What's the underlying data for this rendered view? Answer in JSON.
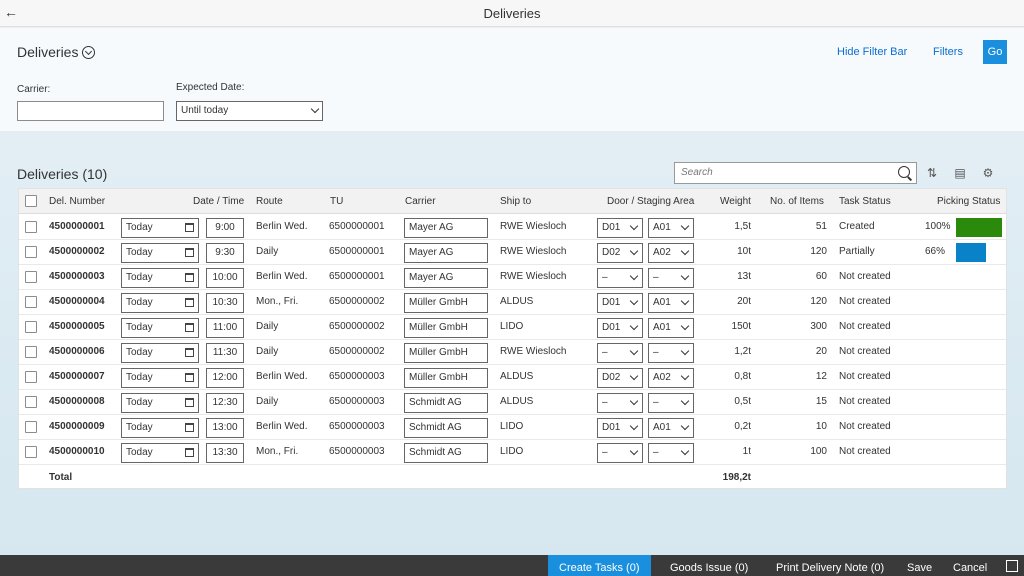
{
  "shell": {
    "title": "Deliveries",
    "back_icon": "back-arrow-icon"
  },
  "filter_bar": {
    "title": "Deliveries",
    "hide_label": "Hide Filter Bar",
    "filters_label": "Filters",
    "go_label": "Go",
    "carrier_label": "Carrier:",
    "carrier_value": "",
    "date_label": "Expected Date:",
    "date_value": "Until today"
  },
  "table": {
    "title": "Deliveries (10)",
    "search_placeholder": "Search",
    "columns": [
      "Del. Number",
      "Date / Time",
      "Route",
      "TU",
      "Carrier",
      "Ship to",
      "Door / Staging Area",
      "Weight",
      "No. of Items",
      "Task Status",
      "Picking Status"
    ],
    "rows": [
      {
        "number": "4500000001",
        "date": "Today",
        "time": "9:00",
        "route": "Berlin Wed.",
        "tu": "6500000001",
        "carrier": "Mayer AG",
        "ship": "RWE Wiesloch",
        "door": "D01",
        "area": "A01",
        "weight": "1,5t",
        "items": "51",
        "status": "Created",
        "pct": "100%",
        "pick": 1.0,
        "pick_color": "#2b8a0b"
      },
      {
        "number": "4500000002",
        "date": "Today",
        "time": "9:30",
        "route": "Daily",
        "tu": "6500000001",
        "carrier": "Mayer AG",
        "ship": "RWE Wiesloch",
        "door": "D02",
        "area": "A02",
        "weight": "10t",
        "items": "120",
        "status": "Partially",
        "pct": "66%",
        "pick": 0.66,
        "pick_color": "#0a82c8"
      },
      {
        "number": "4500000003",
        "date": "Today",
        "time": "10:00",
        "route": "Berlin Wed.",
        "tu": "6500000001",
        "carrier": "Mayer AG",
        "ship": "RWE Wiesloch",
        "door": "–",
        "area": "–",
        "weight": "13t",
        "items": "60",
        "status": "Not created",
        "pct": "",
        "pick": 0,
        "pick_color": ""
      },
      {
        "number": "4500000004",
        "date": "Today",
        "time": "10:30",
        "route": "Mon., Fri.",
        "tu": "6500000002",
        "carrier": "Müller GmbH",
        "ship": "ALDUS",
        "door": "D01",
        "area": "A01",
        "weight": "20t",
        "items": "120",
        "status": "Not created",
        "pct": "",
        "pick": 0,
        "pick_color": ""
      },
      {
        "number": "4500000005",
        "date": "Today",
        "time": "11:00",
        "route": "Daily",
        "tu": "6500000002",
        "carrier": "Müller GmbH",
        "ship": "LIDO",
        "door": "D01",
        "area": "A01",
        "weight": "150t",
        "items": "300",
        "status": "Not created",
        "pct": "",
        "pick": 0,
        "pick_color": ""
      },
      {
        "number": "4500000006",
        "date": "Today",
        "time": "11:30",
        "route": "Daily",
        "tu": "6500000002",
        "carrier": "Müller GmbH",
        "ship": "RWE Wiesloch",
        "door": "–",
        "area": "–",
        "weight": "1,2t",
        "items": "20",
        "status": "Not created",
        "pct": "",
        "pick": 0,
        "pick_color": ""
      },
      {
        "number": "4500000007",
        "date": "Today",
        "time": "12:00",
        "route": "Berlin Wed.",
        "tu": "6500000003",
        "carrier": "Müller GmbH",
        "ship": "ALDUS",
        "door": "D02",
        "area": "A02",
        "weight": "0,8t",
        "items": "12",
        "status": "Not created",
        "pct": "",
        "pick": 0,
        "pick_color": ""
      },
      {
        "number": "4500000008",
        "date": "Today",
        "time": "12:30",
        "route": "Daily",
        "tu": "6500000003",
        "carrier": "Schmidt AG",
        "ship": "ALDUS",
        "door": "–",
        "area": "–",
        "weight": "0,5t",
        "items": "15",
        "status": "Not created",
        "pct": "",
        "pick": 0,
        "pick_color": ""
      },
      {
        "number": "4500000009",
        "date": "Today",
        "time": "13:00",
        "route": "Berlin Wed.",
        "tu": "6500000003",
        "carrier": "Schmidt AG",
        "ship": "LIDO",
        "door": "D01",
        "area": "A01",
        "weight": "0,2t",
        "items": "10",
        "status": "Not created",
        "pct": "",
        "pick": 0,
        "pick_color": ""
      },
      {
        "number": "4500000010",
        "date": "Today",
        "time": "13:30",
        "route": "Mon., Fri.",
        "tu": "6500000003",
        "carrier": "Schmidt AG",
        "ship": "LIDO",
        "door": "–",
        "area": "–",
        "weight": "1t",
        "items": "100",
        "status": "Not created",
        "pct": "",
        "pick": 0,
        "pick_color": ""
      }
    ],
    "total_label": "Total",
    "total_weight": "198,2t"
  },
  "footer": {
    "create_tasks": "Create Tasks (0)",
    "goods_issue": "Goods Issue (0)",
    "print_note": "Print Delivery Note (0)",
    "save": "Save",
    "cancel": "Cancel"
  },
  "colors": {
    "accent": "#1a8fde",
    "link": "#0a6ed1",
    "footer": "#3a3a3a"
  }
}
